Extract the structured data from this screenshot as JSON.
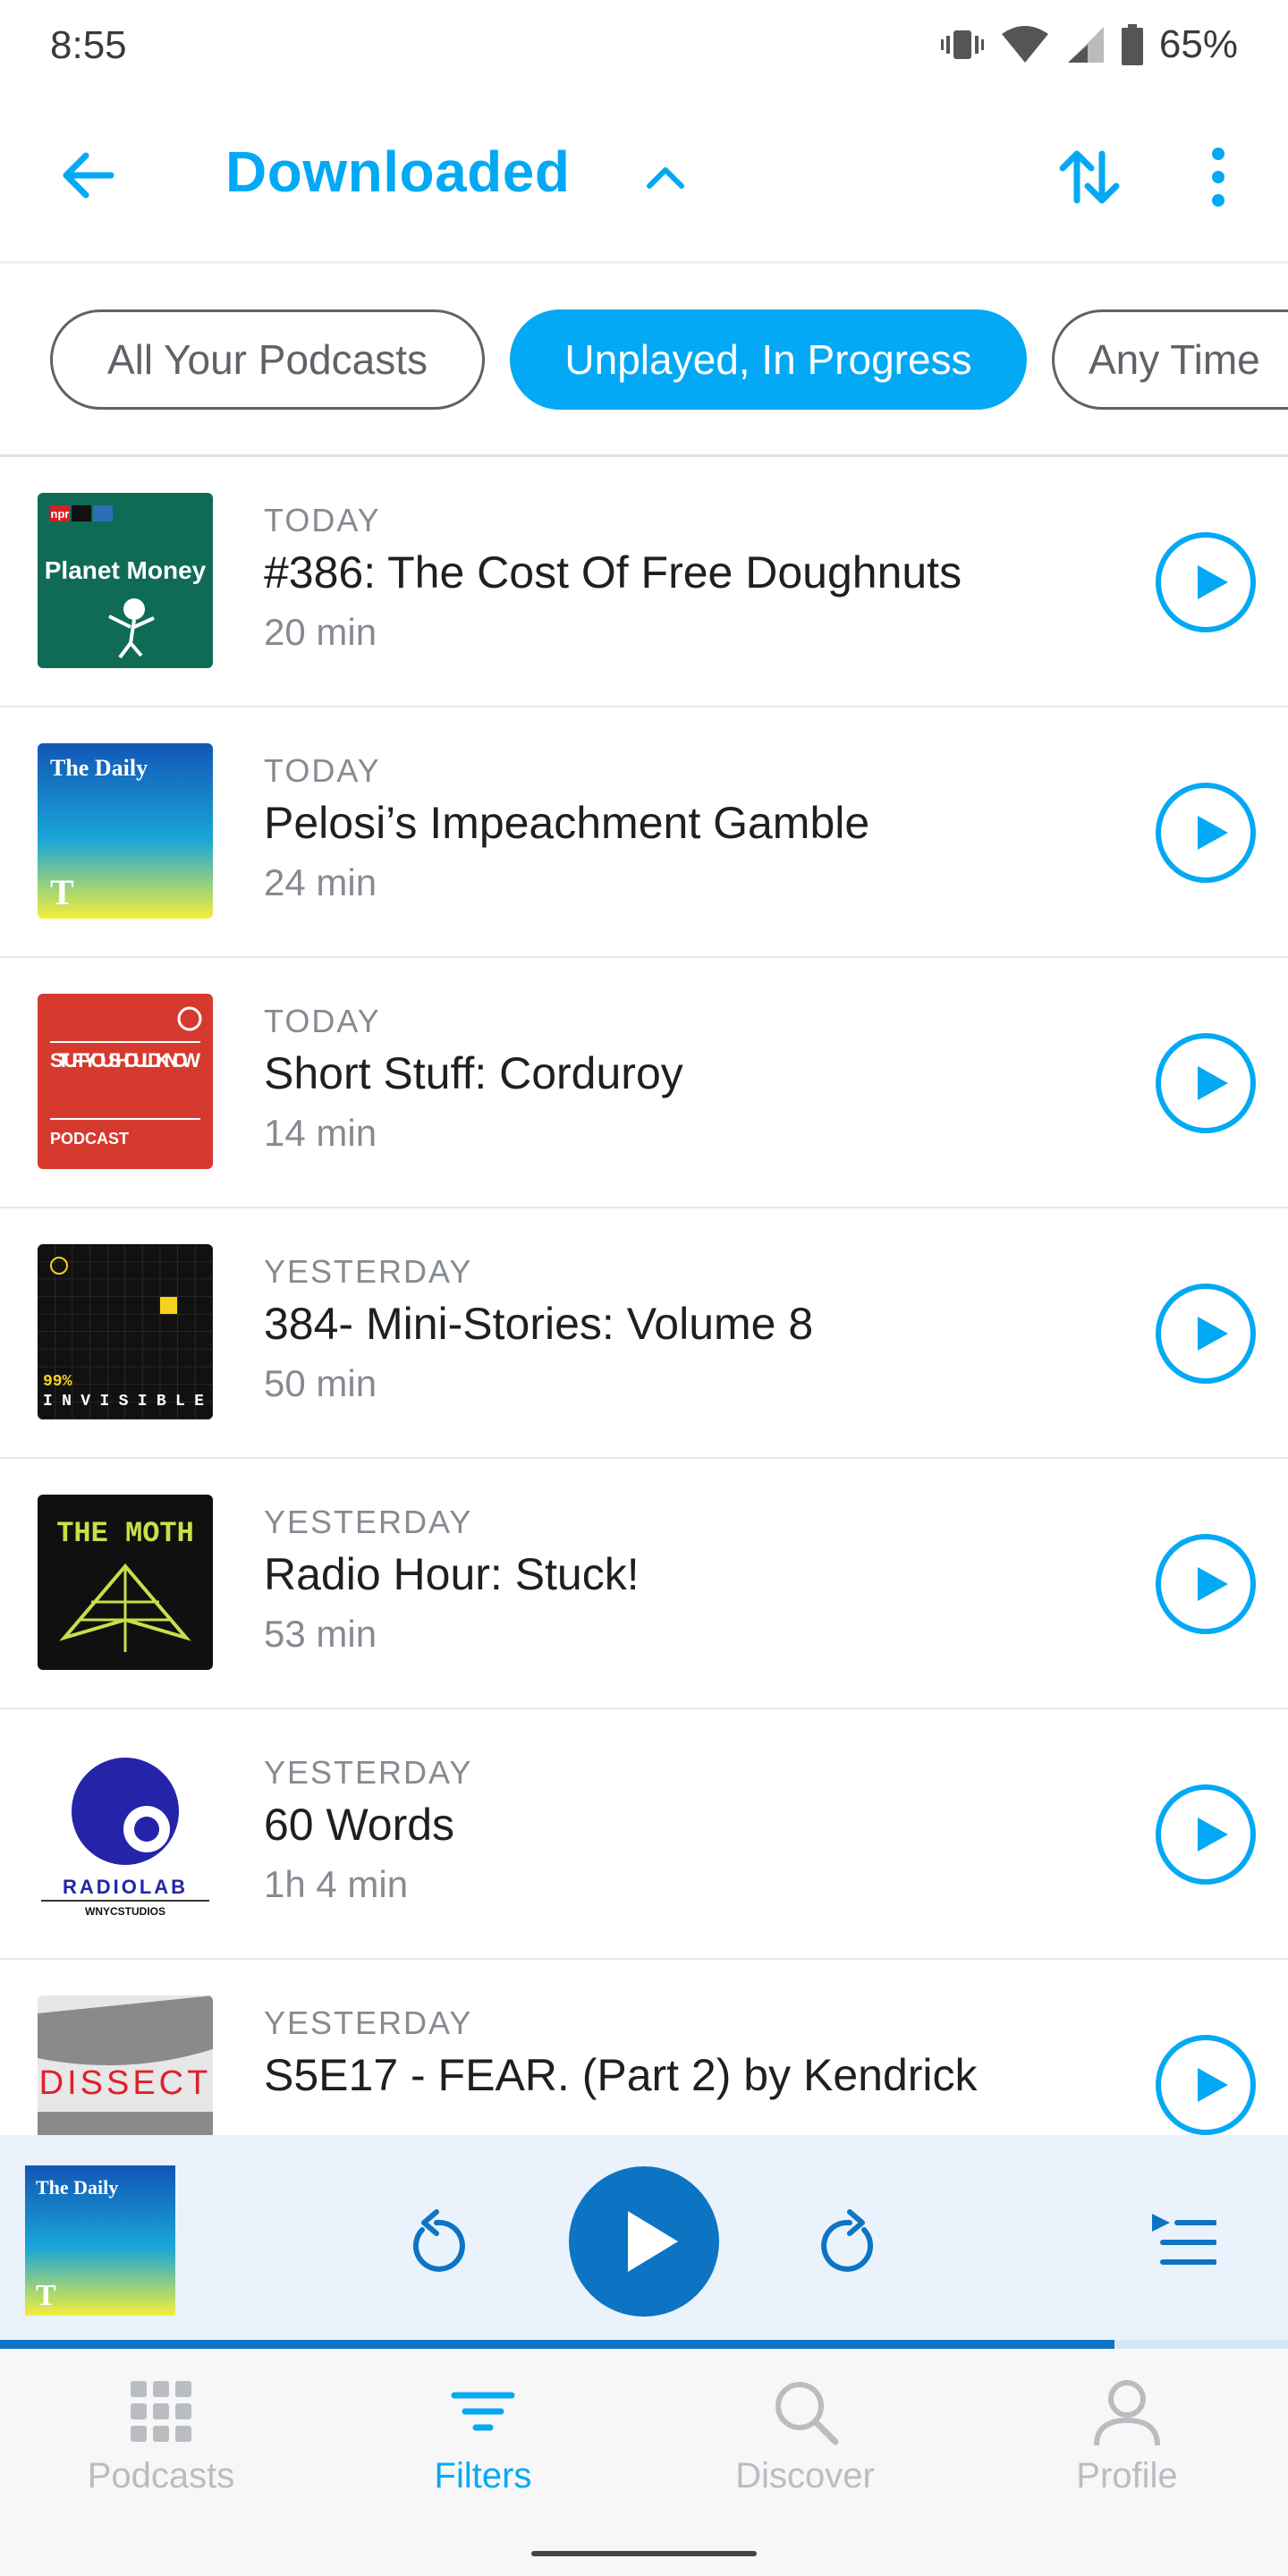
{
  "status": {
    "time": "8:55",
    "battery": "65%"
  },
  "header": {
    "title": "Downloaded"
  },
  "filters": [
    {
      "label": "All Your Podcasts",
      "active": false
    },
    {
      "label": "Unplayed, In Progress",
      "active": true
    },
    {
      "label": "Any Time",
      "active": false
    }
  ],
  "episodes": [
    {
      "date": "TODAY",
      "title": "#386: The Cost Of Free Doughnuts",
      "duration": "20 min",
      "art": {
        "brand": "npr",
        "name": "Planet Money"
      }
    },
    {
      "date": "TODAY",
      "title": "Pelosi’s Impeachment Gamble",
      "duration": "24 min",
      "art": {
        "name": "The Daily"
      }
    },
    {
      "date": "TODAY",
      "title": "Short Stuff: Corduroy",
      "duration": "14 min",
      "art": {
        "name": "STUFF YOU SHOULD KNOW",
        "sub": "PODCAST"
      }
    },
    {
      "date": "YESTERDAY",
      "title": "384- Mini-Stories: Volume 8",
      "duration": "50 min",
      "art": {
        "pct": "99%",
        "name": "INVISIBLE"
      }
    },
    {
      "date": "YESTERDAY",
      "title": "Radio Hour: Stuck!",
      "duration": "53 min",
      "art": {
        "name": "THE MOTH"
      }
    },
    {
      "date": "YESTERDAY",
      "title": "60 Words",
      "duration": "1h 4 min",
      "art": {
        "name": "RADIOLAB",
        "sub": "WNYCSTUDIOS"
      }
    },
    {
      "date": "YESTERDAY",
      "title": "S5E17 - FEAR. (Part 2) by Kendrick",
      "duration": "",
      "art": {
        "name": "DISSECT"
      }
    }
  ],
  "player": {
    "art_name": "The Daily",
    "progress_fraction": 0.865
  },
  "nav": [
    {
      "label": "Podcasts",
      "active": false
    },
    {
      "label": "Filters",
      "active": true
    },
    {
      "label": "Discover",
      "active": false
    },
    {
      "label": "Profile",
      "active": false
    }
  ],
  "colors": {
    "accent": "#03a9f4",
    "player_blue": "#0d74c4",
    "muted": "#868b91"
  },
  "icons": [
    "back-arrow-icon",
    "chevron-up-icon",
    "sort-icon",
    "more-vert-icon",
    "play-icon",
    "rewind-icon",
    "fast-forward-icon",
    "queue-icon",
    "grid-icon",
    "filter-icon",
    "search-icon",
    "person-icon"
  ]
}
